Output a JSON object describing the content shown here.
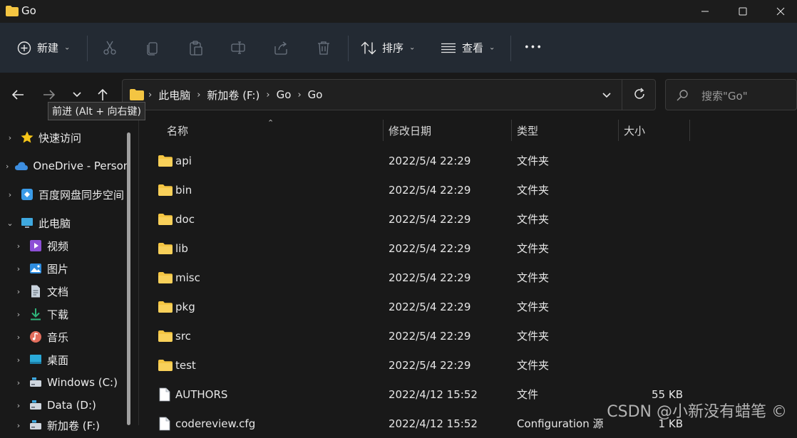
{
  "window": {
    "title": "Go"
  },
  "toolbar": {
    "new_label": "新建",
    "sort_label": "排序",
    "view_label": "查看",
    "more_label": "•••"
  },
  "nav": {
    "tooltip": "前进 (Alt + 向右键)",
    "breadcrumb": [
      "此电脑",
      "新加卷 (F:)",
      "Go",
      "Go"
    ],
    "search_placeholder": "搜索\"Go\""
  },
  "sidebar": {
    "items": [
      {
        "label": "快速访问",
        "icon": "star-icon"
      },
      {
        "label": "OneDrive - Personal",
        "icon": "cloud-icon"
      },
      {
        "label": "百度网盘同步空间",
        "icon": "baidu-icon"
      },
      {
        "label": "此电脑",
        "icon": "computer-icon"
      },
      {
        "label": "视频",
        "icon": "video-icon"
      },
      {
        "label": "图片",
        "icon": "pictures-icon"
      },
      {
        "label": "文档",
        "icon": "documents-icon"
      },
      {
        "label": "下载",
        "icon": "download-icon"
      },
      {
        "label": "音乐",
        "icon": "music-icon"
      },
      {
        "label": "桌面",
        "icon": "desktop-icon"
      },
      {
        "label": "Windows (C:)",
        "icon": "drive-icon"
      },
      {
        "label": "Data (D:)",
        "icon": "drive-icon"
      },
      {
        "label": "新加卷 (F:)",
        "icon": "drive-icon"
      }
    ]
  },
  "filelist": {
    "headers": {
      "name": "名称",
      "modified": "修改日期",
      "type": "类型",
      "size": "大小"
    },
    "rows": [
      {
        "name": "api",
        "modified": "2022/5/4 22:29",
        "type": "文件夹",
        "size": "",
        "icon": "folder-icon"
      },
      {
        "name": "bin",
        "modified": "2022/5/4 22:29",
        "type": "文件夹",
        "size": "",
        "icon": "folder-icon"
      },
      {
        "name": "doc",
        "modified": "2022/5/4 22:29",
        "type": "文件夹",
        "size": "",
        "icon": "folder-icon"
      },
      {
        "name": "lib",
        "modified": "2022/5/4 22:29",
        "type": "文件夹",
        "size": "",
        "icon": "folder-icon"
      },
      {
        "name": "misc",
        "modified": "2022/5/4 22:29",
        "type": "文件夹",
        "size": "",
        "icon": "folder-icon"
      },
      {
        "name": "pkg",
        "modified": "2022/5/4 22:29",
        "type": "文件夹",
        "size": "",
        "icon": "folder-icon"
      },
      {
        "name": "src",
        "modified": "2022/5/4 22:29",
        "type": "文件夹",
        "size": "",
        "icon": "folder-icon"
      },
      {
        "name": "test",
        "modified": "2022/5/4 22:29",
        "type": "文件夹",
        "size": "",
        "icon": "folder-icon"
      },
      {
        "name": "AUTHORS",
        "modified": "2022/4/12 15:52",
        "type": "文件",
        "size": "55 KB",
        "icon": "file-icon"
      },
      {
        "name": "codereview.cfg",
        "modified": "2022/4/12 15:52",
        "type": "Configuration 源",
        "size": "1 KB",
        "icon": "file-icon"
      }
    ]
  },
  "watermark": "CSDN @小新没有蜡笔 ©",
  "colors": {
    "folder": "#f4c542",
    "toolbar_bg": "#232a33",
    "window_bg": "#191919"
  }
}
